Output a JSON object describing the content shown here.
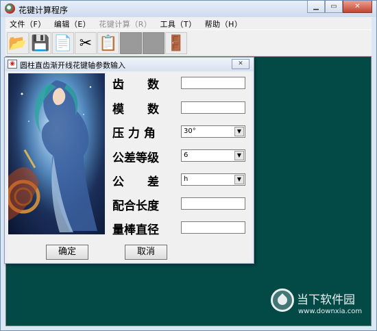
{
  "window": {
    "title": "花键计算程序"
  },
  "menu": [
    {
      "label": "文件（F）",
      "disabled": false
    },
    {
      "label": "编辑（E）",
      "disabled": false
    },
    {
      "label": "花键计算（R）",
      "disabled": true
    },
    {
      "label": "工具（T）",
      "disabled": false
    },
    {
      "label": "帮助（H）",
      "disabled": false
    }
  ],
  "toolbar": [
    {
      "icon": "open-folder-icon",
      "glyph": "📂"
    },
    {
      "icon": "save-disk-icon",
      "glyph": "💾"
    },
    {
      "icon": "copy-icon",
      "glyph": "📄"
    },
    {
      "icon": "cut-scissors-icon",
      "glyph": "✂"
    },
    {
      "icon": "paste-icon",
      "glyph": "📋"
    },
    {
      "icon": "disabled-icon",
      "glyph": ""
    },
    {
      "icon": "disabled-icon",
      "glyph": ""
    },
    {
      "icon": "exit-door-icon",
      "glyph": "🚪"
    }
  ],
  "dialog": {
    "title": "圆柱直齿渐开线花键轴参数输入",
    "close_glyph": "✕",
    "fields": {
      "teeth": {
        "label": "齿　　数",
        "value": ""
      },
      "module": {
        "label": "模　　数",
        "value": ""
      },
      "pressure_angle": {
        "label": "压 力 角",
        "value": "30°"
      },
      "tolerance_grade": {
        "label": "公差等级",
        "value": "6"
      },
      "tolerance": {
        "label": "公　　差",
        "value": "h"
      },
      "fit_length": {
        "label": "配合长度",
        "value": ""
      },
      "gauge_diameter": {
        "label": "量棒直径",
        "value": ""
      }
    },
    "ok_label": "确定",
    "cancel_label": "取消"
  },
  "watermark": {
    "title": "当下软件园",
    "url": "www.downxia.com"
  }
}
